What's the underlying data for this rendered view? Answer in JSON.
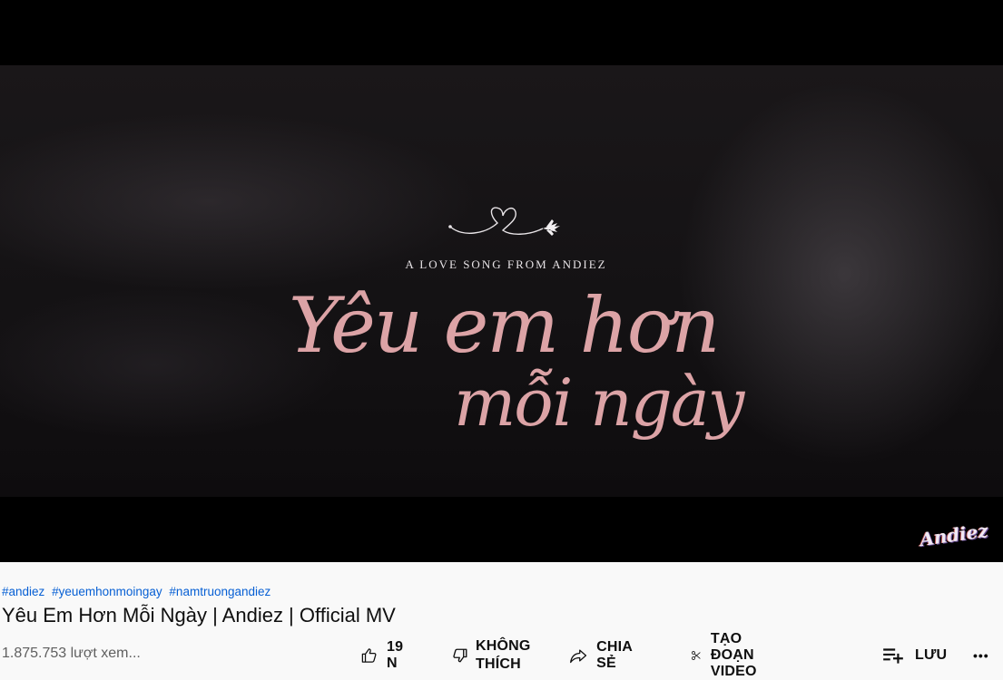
{
  "video": {
    "overlay_tagline": "A LOVE SONG FROM ANDIEZ",
    "overlay_title_line1": "Yêu em hơn",
    "overlay_title_line2": "mỗi ngày",
    "watermark": "Andiez"
  },
  "info": {
    "hashtags": [
      "#andiez",
      "#yeuemhonmoingay",
      "#namtruongandiez"
    ],
    "title": "Yêu Em Hơn Mỗi Ngày | Andiez | Official MV",
    "views": "1.875.753 lượt xem..."
  },
  "actions": {
    "like_count": "19 N",
    "dislike_line1": "KHÔNG",
    "dislike_line2": "THÍCH",
    "share": "CHIA SẺ",
    "clip": "TẠO ĐOẠN VIDEO",
    "save": "LƯU",
    "more": "•••"
  },
  "icons": {
    "like": "thumbs-up-icon",
    "dislike": "thumbs-down-icon",
    "share": "share-arrow-icon",
    "clip": "scissors-icon",
    "save": "playlist-add-icon",
    "more": "more-horizontal-icon"
  },
  "colors": {
    "link": "#065fd4",
    "script_pink": "#dca3a6",
    "secondary_text": "#606060"
  }
}
